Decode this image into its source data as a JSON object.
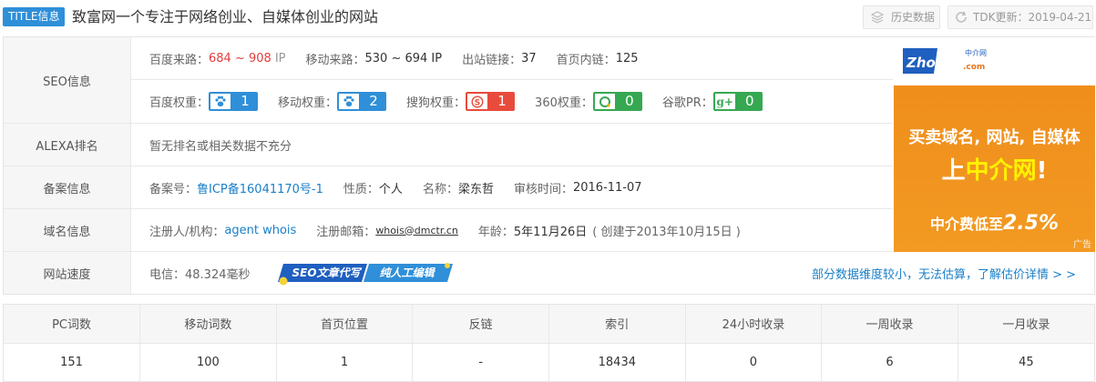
{
  "header": {
    "badge": "TITLE信息",
    "title": "致富网一个专注于网络创业、自媒体创业的网站",
    "history_label": "历史数据",
    "tdk_label": "TDK更新：2019-04-21"
  },
  "seo": {
    "label": "SEO信息",
    "baidu_source_key": "百度来路：",
    "baidu_source_val": "684 ~ 908",
    "baidu_source_unit": "IP",
    "mobile_source_key": "移动来路：",
    "mobile_source_val": "530 ~ 694 IP",
    "outlinks_key": "出站链接：",
    "outlinks_val": "37",
    "home_links_key": "首页内链：",
    "home_links_val": "125",
    "baidu_weight_key": "百度权重：",
    "baidu_weight_val": "1",
    "mobile_weight_key": "移动权重：",
    "mobile_weight_val": "2",
    "sogou_weight_key": "搜狗权重：",
    "sogou_weight_val": "1",
    "q360_weight_key": "360权重：",
    "q360_weight_val": "0",
    "google_pr_key": "谷歌PR：",
    "google_pr_val": "0",
    "google_icon_text": "g+"
  },
  "alexa": {
    "label": "ALEXA排名",
    "value": "暂无排名或相关数据不充分"
  },
  "icp": {
    "label": "备案信息",
    "no_key": "备案号：",
    "no_val": "鲁ICP备16041170号-1",
    "type_key": "性质：",
    "type_val": "个人",
    "name_key": "名称：",
    "name_val": "梁东哲",
    "time_key": "审核时间：",
    "time_val": "2016-11-07"
  },
  "domain": {
    "label": "域名信息",
    "registrant_key": "注册人/机构：",
    "registrant_val": "agent whois",
    "email_key": "注册邮箱：",
    "email_val": "whois@dmctr.cn",
    "age_key": "年龄：",
    "age_val": "5年11月26日",
    "created_val": "( 创建于2013年10月15日 )"
  },
  "speed": {
    "label": "网站速度",
    "telecom": "电信：48.324毫秒",
    "promo_left": "SEO文章代写",
    "promo_right": "纯人工编辑",
    "link": "部分数据维度较小，无法估算，了解估价详情 > >"
  },
  "ad": {
    "logo_text": "Zhongjie",
    "logo_sub": "中介网",
    "logo_dotcom": ".com",
    "line1": "买卖域名, 网站, 自媒体",
    "line2_a": "上",
    "line2_b": "中介网",
    "line2_c": "!",
    "line3_a": "中介费低至",
    "line3_b": "2.5%",
    "tag": "广告"
  },
  "stats": {
    "headers": [
      "PC词数",
      "移动词数",
      "首页位置",
      "反链",
      "索引",
      "24小时收录",
      "一周收录",
      "一月收录"
    ],
    "values": [
      "151",
      "100",
      "1",
      "-",
      "18434",
      "0",
      "6",
      "45"
    ]
  },
  "colors": {
    "accent_blue": "#2f8fd8",
    "link_blue": "#1a80c8",
    "red": "#e23c3c",
    "baidu_blue": "#2f8fd8",
    "sogou_red": "#e84b3c",
    "green_360": "#36a852",
    "ad_orange": "#f0901e"
  }
}
